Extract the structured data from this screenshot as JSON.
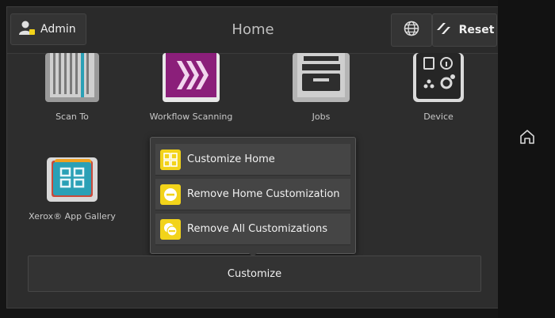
{
  "header": {
    "admin_label": "Admin",
    "title": "Home",
    "reset_label": "Reset"
  },
  "apps": [
    {
      "label": "Scan To",
      "icon": "scan-to-icon"
    },
    {
      "label": "Workflow Scanning",
      "icon": "workflow-scanning-icon"
    },
    {
      "label": "Jobs",
      "icon": "jobs-icon"
    },
    {
      "label": "Device",
      "icon": "device-icon"
    },
    {
      "label": "Xerox® App Gallery",
      "icon": "app-gallery-icon"
    }
  ],
  "customize_menu": {
    "items": [
      {
        "label": "Customize Home",
        "icon": "customize-home-icon"
      },
      {
        "label": "Remove Home Customization",
        "icon": "remove-home-customization-icon"
      },
      {
        "label": "Remove All Customizations",
        "icon": "remove-all-customizations-icon"
      }
    ]
  },
  "footer": {
    "customize_label": "Customize"
  },
  "colors": {
    "accent_yellow": "#f2d31a",
    "workflow_purple": "#8b1f7a",
    "gallery_teal": "#2aa0b6"
  }
}
